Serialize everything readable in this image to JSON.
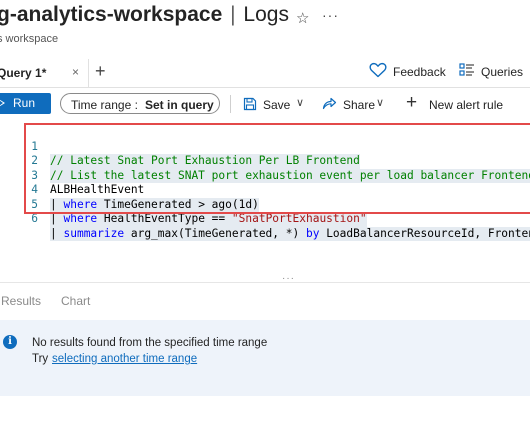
{
  "header": {
    "title": "g-analytics-workspace",
    "separator": "|",
    "section": "Logs",
    "subtitle": "s workspace",
    "more_label": "···",
    "star_glyph": "☆"
  },
  "tabs": [
    {
      "label": "Query 1*",
      "close": "×"
    }
  ],
  "tabbar": {
    "add_glyph": "+",
    "feedback_label": "Feedback",
    "queries_label": "Queries"
  },
  "toolbar": {
    "run_label": "Run",
    "time_range_key": "Time range :",
    "time_range_value": "Set in query",
    "save_label": "Save",
    "share_label": "Share",
    "new_alert_label": "New alert rule",
    "chevron": "∨",
    "plus_glyph": "+"
  },
  "editor": {
    "lines": [
      {
        "num": "1",
        "text": "// Latest Snat Port Exhaustion Per LB Frontend"
      },
      {
        "num": "2",
        "text": "// List the latest SNAT port exhaustion event per load balancer Frontend IP"
      },
      {
        "num": "3",
        "text": "ALBHealthEvent"
      },
      {
        "num": "4",
        "pipe": "| ",
        "kw": "where",
        "rest": " TimeGenerated > ago(1d)"
      },
      {
        "num": "5",
        "pipe": "| ",
        "kw": "where",
        "rest": " HealthEventType == ",
        "str": "\"SnatPortExhaustion\""
      },
      {
        "num": "6",
        "pipe": "| ",
        "kw": "summarize",
        "rest": " arg_max(TimeGenerated, *) ",
        "kw2": "by",
        "rest2": " LoadBalancerResourceId, FrontendIP"
      }
    ]
  },
  "results": {
    "results_tab": "Results",
    "chart_tab": "Chart",
    "splitter": "···",
    "info_icon": "i",
    "message": "No results found from the specified time range",
    "try_label": "Try",
    "try_link": "selecting another time range"
  },
  "colors": {
    "accent": "#0f6cbd",
    "highlight_border": "#e34a4a",
    "comment": "#008000",
    "keyword": "#0000ff",
    "string": "#a31515",
    "info_background": "#eef3fa"
  },
  "icons": [
    "star-icon",
    "more-icon",
    "close-icon",
    "add-tab-icon",
    "heart-icon",
    "queries-icon",
    "play-icon",
    "save-icon",
    "share-icon",
    "chevron-down-icon",
    "plus-icon",
    "info-icon"
  ]
}
